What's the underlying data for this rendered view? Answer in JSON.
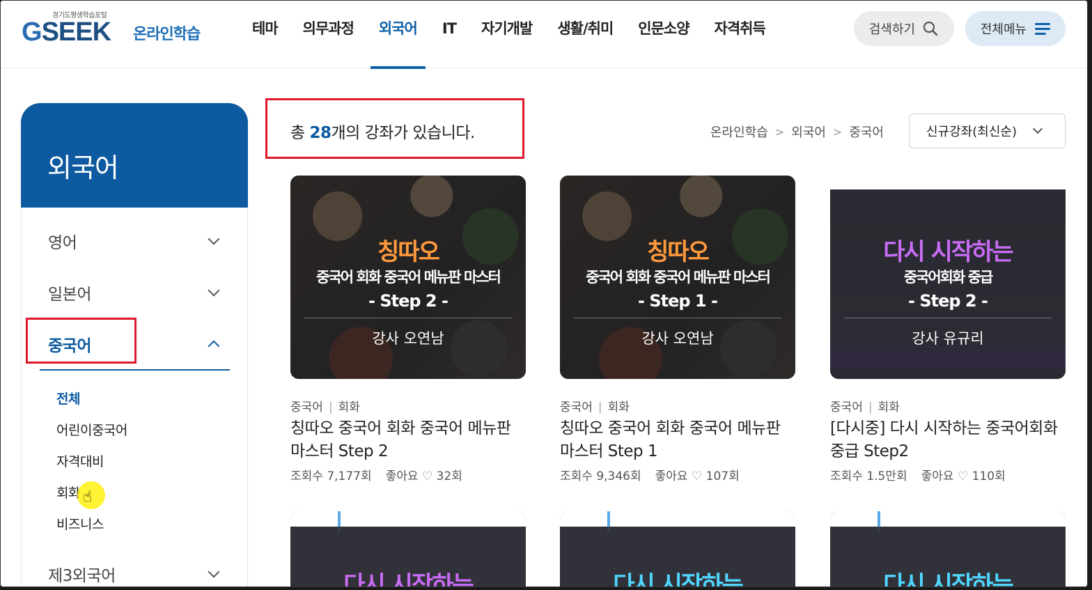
{
  "logo": {
    "small": "경기도평생학습포털",
    "main_g": "G",
    "main_rest": "SEEK",
    "sub": "온라인학습"
  },
  "gnb": [
    "테마",
    "의무과정",
    "외국어",
    "IT",
    "자기개발",
    "생활/취미",
    "인문소양",
    "자격취득"
  ],
  "header": {
    "search_label": "검색하기",
    "menu_label": "전체메뉴"
  },
  "sidebar": {
    "title": "외국어",
    "categories": [
      "영어",
      "일본어",
      "중국어",
      "제3외국어"
    ],
    "sub_items": [
      "전체",
      "어린이중국어",
      "자격대비",
      "회화",
      "비즈니스"
    ]
  },
  "content": {
    "total_prefix": "총 ",
    "total_count": "28",
    "total_suffix": "개의 강좌가 있습니다.",
    "breadcrumb": [
      "온라인학습",
      "외국어",
      "중국어"
    ],
    "sort_label": "신규강좌(최신순)"
  },
  "cards": [
    {
      "thumb_title": "칭따오",
      "thumb_sub": "중국어 회화 중국어 메뉴판 마스터",
      "thumb_step": "- Step 2 -",
      "thumb_teacher": "강사 오연남",
      "cat1": "중국어",
      "cat2": "회화",
      "title": "칭따오 중국어 회화 중국어 메뉴판 마스터 Step 2",
      "views": "조회수 7,177회",
      "likes_label": "좋아요",
      "likes": "32회"
    },
    {
      "thumb_title": "칭따오",
      "thumb_sub": "중국어 회화 중국어 메뉴판 마스터",
      "thumb_step": "- Step 1 -",
      "thumb_teacher": "강사 오연남",
      "cat1": "중국어",
      "cat2": "회화",
      "title": "칭따오 중국어 회화 중국어 메뉴판 마스터 Step 1",
      "views": "조회수 9,346회",
      "likes_label": "좋아요",
      "likes": "107회"
    },
    {
      "thumb_title": "다시 시작하는",
      "thumb_sub": "중국어회화 중급",
      "thumb_step": "- Step 2 -",
      "thumb_teacher": "강사 유규리",
      "cat1": "중국어",
      "cat2": "회화",
      "title": "[다시중] 다시 시작하는 중국어회화 중급 Step2",
      "views": "조회수 1.5만회",
      "likes_label": "좋아요",
      "likes": "110회"
    }
  ],
  "row2": [
    "다시 시작하는",
    "다시 시작하는",
    "다시 시작하는"
  ],
  "colors": {
    "brand": "#0d5aa0",
    "highlight_box": "#e0182b"
  }
}
